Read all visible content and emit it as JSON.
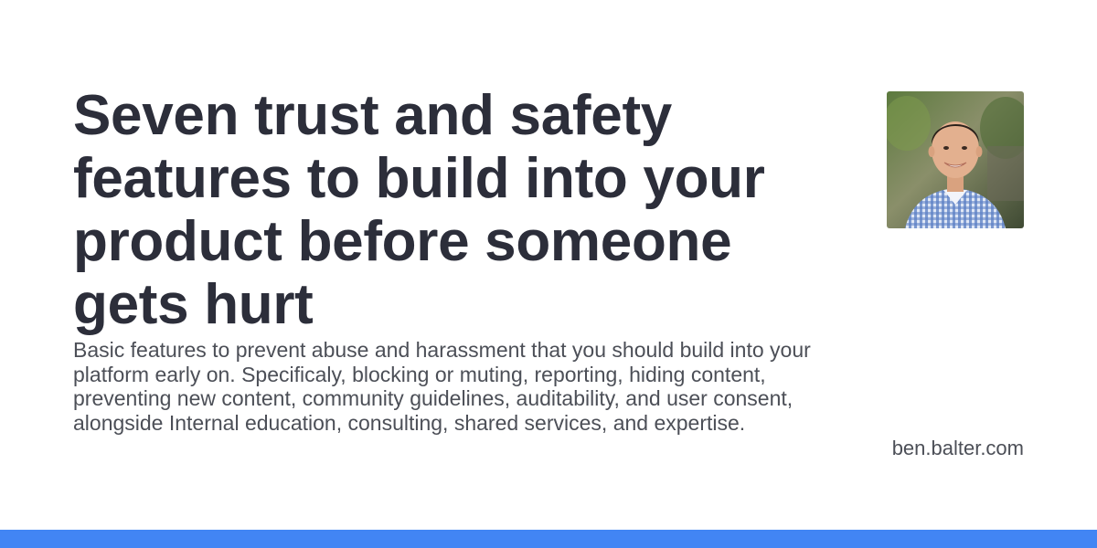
{
  "post": {
    "title": "Seven trust and safety features to build into your product before someone gets hurt",
    "description": "Basic features to prevent abuse and harassment that you should build into your platform early on. Specificaly, blocking or muting, reporting, hiding content, preventing new content, community guidelines, auditability, and user consent, alongside Internal education, consulting, shared services, and expertise."
  },
  "site": {
    "domain": "ben.balter.com"
  },
  "author": {
    "avatar_icon": "author-portrait-photo"
  },
  "colors": {
    "title": "#2c2e3a",
    "body_text": "#4c4f57",
    "accent_bar": "#4285f4",
    "background": "#ffffff"
  }
}
